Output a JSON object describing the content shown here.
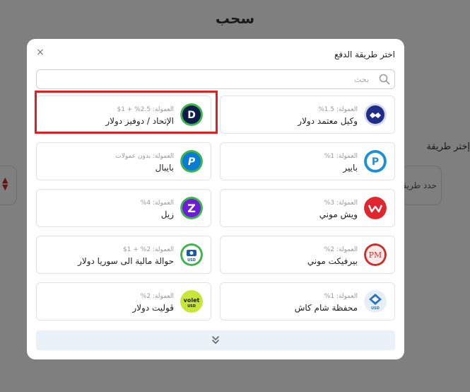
{
  "page": {
    "title": "سحب",
    "method_label": "إختر طريقة",
    "select_placeholder": "حدد طريقة"
  },
  "modal": {
    "title": "اختر طريقة الدفع",
    "close_label": "×",
    "search_placeholder": "بحث",
    "methods": [
      {
        "name": "وكيل معتمد دولار",
        "fee": "العمولة: 1.5%",
        "icon": "agent-handshake-icon",
        "color": "#1f2d8a"
      },
      {
        "name": "الإتحاد / دوفيز دولار",
        "fee": "العمولة: 2.5% + 1$",
        "icon": "doviz-icon",
        "color": "#0d1b4a"
      },
      {
        "name": "بايير",
        "fee": "العمولة: 1%",
        "icon": "payeer-icon",
        "color": "#1f8fd6"
      },
      {
        "name": "بايبال",
        "fee": "العمولة: بدون عمولات",
        "icon": "paypal-icon",
        "color": "#0a7bd4"
      },
      {
        "name": "ويش موني",
        "fee": "العمولة: 3%",
        "icon": "wish-money-icon",
        "color": "#e0262f"
      },
      {
        "name": "زيل",
        "fee": "العمولة: 4%",
        "icon": "zelle-icon",
        "color": "#6d1ed4"
      },
      {
        "name": "بيرفيكت موني",
        "fee": "العمولة: 2%",
        "icon": "perfect-money-icon",
        "color": "#c9302c",
        "logo_text": "PM"
      },
      {
        "name": "حوالة مالية الى سوريا دولار",
        "fee": "العمولة: 2% + 1$",
        "icon": "syria-transfer-icon",
        "color": "#1a5aa8",
        "logo_text": "USD"
      },
      {
        "name": "محفظة شام كاش",
        "fee": "العمولة: 1%",
        "icon": "sham-cash-icon",
        "color": "#2a73c4",
        "logo_text": "USD"
      },
      {
        "name": "ڤوليت دولار",
        "fee": "العمولة: 2%",
        "icon": "volet-icon",
        "color": "#c8e63a",
        "logo_text": "volet",
        "logo_sub": "USD"
      }
    ]
  },
  "colors": {
    "highlight": "#e02020",
    "more_button_bg": "#e8f2f8"
  }
}
